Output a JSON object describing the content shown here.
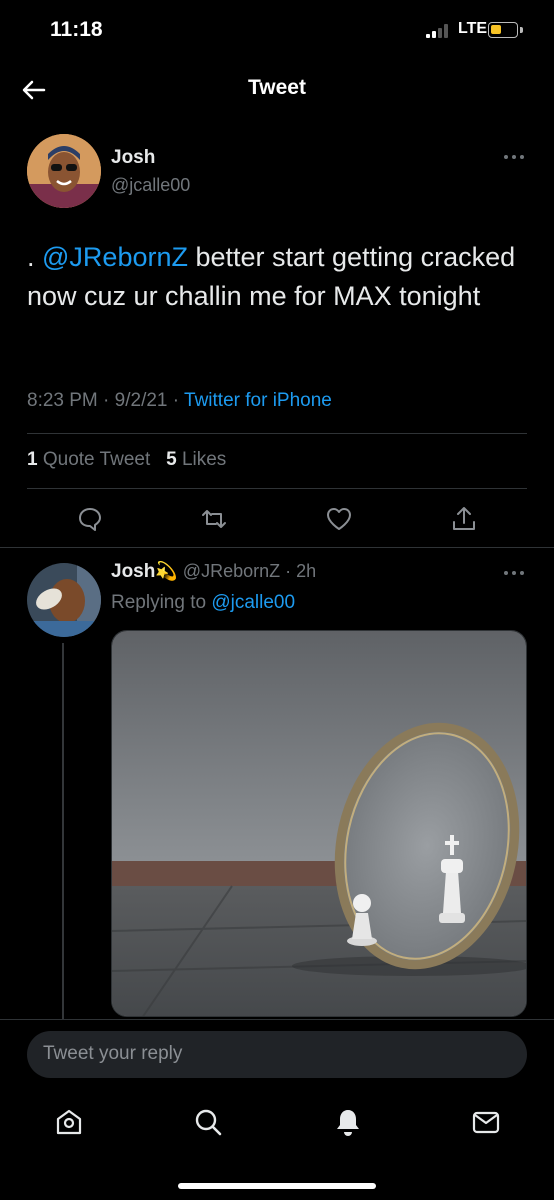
{
  "status_bar": {
    "time": "11:18",
    "network": "LTE",
    "battery_level": 0.45,
    "battery_color": "#f7c325"
  },
  "header": {
    "title": "Tweet",
    "back_icon": "arrow-left-icon"
  },
  "tweet": {
    "author_name": "Josh",
    "author_handle": "@jcalle00",
    "text_prefix": ". ",
    "mention": "@JRebornZ",
    "text_rest": " better start getting cracked now cuz ur challin me for MAX tonight",
    "time": "8:23 PM",
    "date": "9/2/21",
    "client": "Twitter for iPhone",
    "quote_count": "1",
    "quote_label": "Quote Tweet",
    "like_count": "5",
    "like_label": "Likes",
    "actions": [
      "reply-icon",
      "retweet-icon",
      "like-icon",
      "share-icon"
    ]
  },
  "reply": {
    "author_name": "Josh",
    "emoji": "💫",
    "author_handle": "@JRebornZ",
    "age": "2h",
    "replying_prefix": "Replying to ",
    "replying_to": "@jcalle00"
  },
  "compose": {
    "placeholder": "Tweet your reply"
  },
  "tab_bar": [
    "home-icon",
    "search-icon",
    "notifications-icon",
    "messages-icon"
  ],
  "colors": {
    "accent": "#1d9bf0",
    "background": "#000000",
    "muted": "#71767b"
  }
}
